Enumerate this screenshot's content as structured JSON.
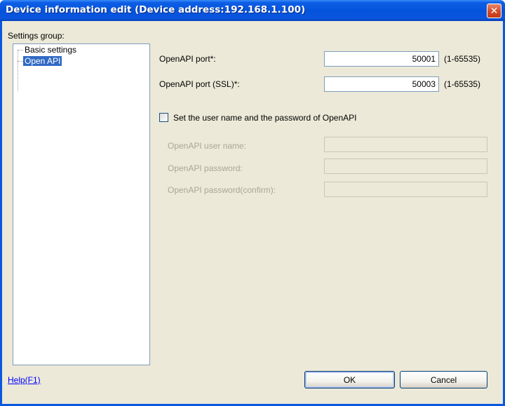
{
  "window": {
    "title": "Device information edit (Device address:192.168.1.100)",
    "close_glyph": "✕"
  },
  "settings_group": {
    "label": "Settings group:",
    "items": [
      {
        "label": "Basic settings",
        "selected": false
      },
      {
        "label": "Open API",
        "selected": true
      }
    ]
  },
  "form": {
    "openapi_port": {
      "label": "OpenAPI port*:",
      "value": "50001",
      "range": "(1-65535)"
    },
    "openapi_port_ssl": {
      "label": "OpenAPI port (SSL)*:",
      "value": "50003",
      "range": "(1-65535)"
    },
    "credentials_checkbox": {
      "label": "Set the user name and the password of OpenAPI",
      "checked": false
    },
    "user_name": {
      "label": "OpenAPI user name:",
      "value": ""
    },
    "password": {
      "label": "OpenAPI password:",
      "value": ""
    },
    "password_confirm": {
      "label": "OpenAPI password(confirm):",
      "value": ""
    }
  },
  "footer": {
    "help_link": "Help(F1)",
    "ok_label": "OK",
    "cancel_label": "Cancel"
  },
  "icons": {
    "close": "close-icon"
  }
}
